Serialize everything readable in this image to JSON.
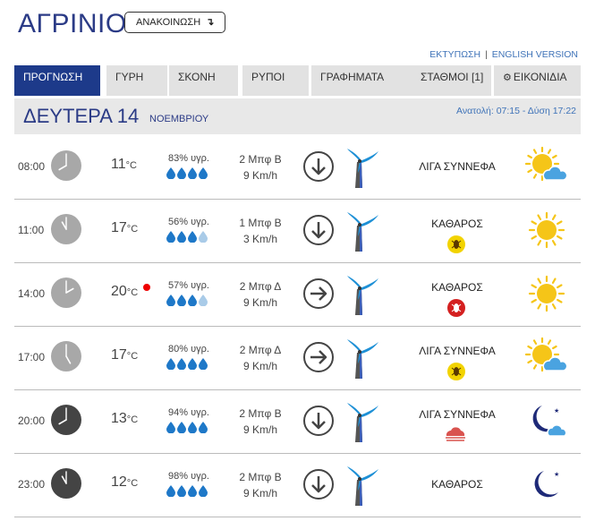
{
  "header": {
    "city": "ΑΓΡΙΝΙΟ",
    "announce_label": "ΑΝΑΚΟΙΝΩΣΗ",
    "announce_arrow": "↴",
    "print_link": "ΕΚΤΥΠΩΣΗ",
    "separator": "|",
    "english_link": "ENGLISH VERSION"
  },
  "tabs": [
    {
      "label": "ΠΡΟΓΝΩΣΗ",
      "active": true
    },
    {
      "label": "ΓΥΡΗ",
      "active": false
    },
    {
      "label": "ΣΚΟΝΗ",
      "active": false
    },
    {
      "label": "ΡΥΠΟΙ",
      "active": false
    },
    {
      "label": "ΓΡΑΦΗΜΑΤΑ",
      "active": false
    },
    {
      "label": "ΣΤΑΘΜΟΙ [1]",
      "active": false
    },
    {
      "label": "ΕΙΚΟΝΙΔΙΑ",
      "active": false,
      "icon": "gear-icon"
    }
  ],
  "day": {
    "name": "ΔΕΥΤΕΡΑ 14",
    "month": "ΝΟΕΜΒΡΙΟΥ",
    "sun": "Ανατολή: 07:15  - Δύση 17:22"
  },
  "colors": {
    "accent": "#1d3a8a",
    "title": "#2b3b86",
    "link": "#3f73b8",
    "tab_bg": "#e2e2e2",
    "drop_full": "#1e78c8",
    "drop_light": "#a9cbe8",
    "alert": "#ee0000",
    "sun": "#f5c518",
    "cloud": "#4aa3e0",
    "moon": "#1e2a78"
  },
  "rows": [
    {
      "time": "08:00",
      "night": false,
      "temp": "11",
      "unit": "°C",
      "alert": false,
      "humidity": "83% υγρ.",
      "drops_full": 4,
      "wind_force": "2 Μπφ Β",
      "wind_speed": "9 Km/h",
      "wind_dir": "down-arrow-icon",
      "condition": "ΛΙΓΑ ΣΥΝΝΕΦΑ",
      "dust": null,
      "weather_icon": "sun-cloud-icon"
    },
    {
      "time": "11:00",
      "night": false,
      "temp": "17",
      "unit": "°C",
      "alert": false,
      "humidity": "56% υγρ.",
      "drops_full": 3,
      "wind_force": "1 Μπφ Β",
      "wind_speed": "3 Km/h",
      "wind_dir": "down-arrow-icon",
      "condition": "ΚΑΘΑΡΟΣ",
      "dust": "yellow-dust-icon",
      "weather_icon": "sun-icon"
    },
    {
      "time": "14:00",
      "night": false,
      "temp": "20",
      "unit": "°C",
      "alert": true,
      "humidity": "57% υγρ.",
      "drops_full": 3,
      "wind_force": "2 Μπφ Δ",
      "wind_speed": "9 Km/h",
      "wind_dir": "right-arrow-icon",
      "condition": "ΚΑΘΑΡΟΣ",
      "dust": "red-dust-icon",
      "weather_icon": "sun-icon"
    },
    {
      "time": "17:00",
      "night": false,
      "temp": "17",
      "unit": "°C",
      "alert": false,
      "humidity": "80% υγρ.",
      "drops_full": 4,
      "wind_force": "2 Μπφ Δ",
      "wind_speed": "9 Km/h",
      "wind_dir": "right-arrow-icon",
      "condition": "ΛΙΓΑ ΣΥΝΝΕΦΑ",
      "dust": "yellow-dust-icon",
      "weather_icon": "sun-cloud-icon"
    },
    {
      "time": "20:00",
      "night": true,
      "temp": "13",
      "unit": "°C",
      "alert": false,
      "humidity": "94% υγρ.",
      "drops_full": 4,
      "wind_force": "2 Μπφ Β",
      "wind_speed": "9 Km/h",
      "wind_dir": "down-arrow-icon",
      "condition": "ΛΙΓΑ ΣΥΝΝΕΦΑ",
      "dust": "haze-cloud-icon",
      "weather_icon": "moon-cloud-icon"
    },
    {
      "time": "23:00",
      "night": true,
      "temp": "12",
      "unit": "°C",
      "alert": false,
      "humidity": "98% υγρ.",
      "drops_full": 4,
      "wind_force": "2 Μπφ Β",
      "wind_speed": "9 Km/h",
      "wind_dir": "down-arrow-icon",
      "condition": "ΚΑΘΑΡΟΣ",
      "dust": null,
      "weather_icon": "moon-icon"
    }
  ]
}
